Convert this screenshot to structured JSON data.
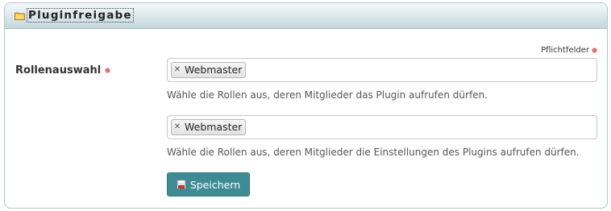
{
  "panel": {
    "title": "Pluginfreigabe",
    "icon": "folder-icon"
  },
  "form": {
    "required_note": "Pflichtfelder",
    "role_label": "Rollenauswahl",
    "field_plugin_access": {
      "tags": [
        "Webmaster"
      ],
      "help": "Wähle die Rollen aus, deren Mitglieder das Plugin aufrufen dürfen."
    },
    "field_plugin_settings": {
      "tags": [
        "Webmaster"
      ],
      "help": "Wähle die Rollen aus, deren Mitglieder die Einstellungen des Plugins aufrufen dürfen."
    },
    "save_label": "Speichern",
    "save_icon": "save-icon"
  },
  "colors": {
    "accent": "#3e8b94",
    "required": "#e66a6a",
    "header_top": "#f4f9fa",
    "header_bottom": "#c5d7dc"
  }
}
